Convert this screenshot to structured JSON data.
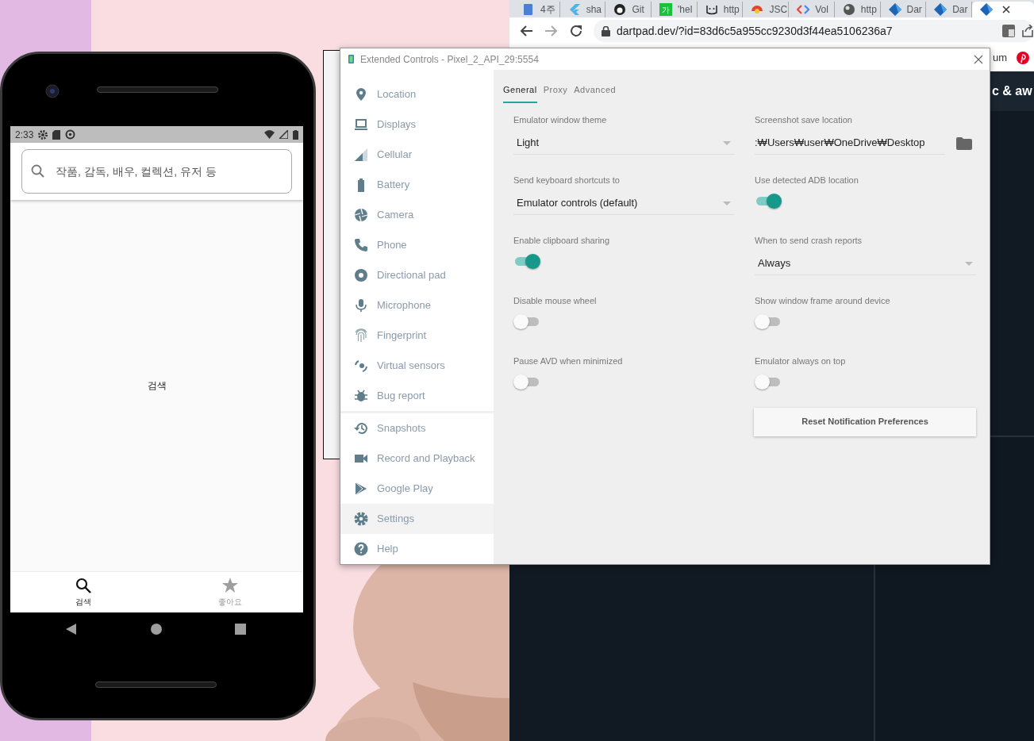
{
  "phone": {
    "status_time": "2:33",
    "search": {
      "placeholder": "작품, 감독, 배우, 컬렉션, 유저 등"
    },
    "body_text": "검색",
    "bottom_nav": [
      {
        "label": "검색",
        "selected": true
      },
      {
        "label": "좋아요",
        "selected": false
      }
    ]
  },
  "browser": {
    "tabs": [
      {
        "label": "4주",
        "selected": false
      },
      {
        "label": "sha",
        "selected": false
      },
      {
        "label": "Git",
        "selected": false
      },
      {
        "label": "'hel",
        "icon_text": "가",
        "selected": false
      },
      {
        "label": "http",
        "selected": false
      },
      {
        "label": "JSC",
        "selected": false
      },
      {
        "label": "Vol",
        "selected": false
      },
      {
        "label": "http",
        "selected": false
      },
      {
        "label": "Dar",
        "selected": false
      },
      {
        "label": "Dar",
        "selected": false
      },
      {
        "selected": true
      }
    ],
    "url": "dartpad.dev/?id=83d6c5a955cc9230d3f44ea5106236a7",
    "bookmark": "um",
    "page_heading": "c & aw"
  },
  "extended_controls": {
    "title": "Extended Controls - Pixel_2_API_29:5554",
    "sidebar": [
      [
        {
          "label": "Location",
          "selected": false
        },
        {
          "label": "Displays",
          "selected": false
        },
        {
          "label": "Cellular",
          "selected": false
        },
        {
          "label": "Battery",
          "selected": false
        },
        {
          "label": "Camera",
          "selected": false
        },
        {
          "label": "Phone",
          "selected": false
        },
        {
          "label": "Directional pad",
          "selected": false
        },
        {
          "label": "Microphone",
          "selected": false
        },
        {
          "label": "Fingerprint",
          "selected": false
        },
        {
          "label": "Virtual sensors",
          "selected": false
        },
        {
          "label": "Bug report",
          "selected": false
        }
      ],
      [
        {
          "label": "Snapshots",
          "selected": false
        },
        {
          "label": "Record and Playback",
          "selected": false
        },
        {
          "label": "Google Play",
          "selected": false
        },
        {
          "label": "Settings",
          "selected": true
        },
        {
          "label": "Help",
          "selected": false
        }
      ]
    ],
    "tabs": [
      {
        "label": "General",
        "selected": true
      },
      {
        "label": "Proxy",
        "selected": false
      },
      {
        "label": "Advanced",
        "selected": false
      }
    ],
    "settings": [
      {
        "kind": "select",
        "label": "Emulator window theme",
        "value": "Light"
      },
      {
        "kind": "path",
        "label": "Screenshot save location",
        "value": ":₩Users₩user₩OneDrive₩Desktop"
      },
      {
        "kind": "select",
        "label": "Send keyboard shortcuts to",
        "value": "Emulator controls (default)"
      },
      {
        "kind": "switch",
        "label": "Use detected ADB location",
        "on": true
      },
      {
        "kind": "switch",
        "label": "Enable clipboard sharing",
        "on": true
      },
      {
        "kind": "select",
        "label": "When to send crash reports",
        "value": "Always"
      },
      {
        "kind": "switch",
        "label": "Disable mouse wheel",
        "on": false
      },
      {
        "kind": "switch",
        "label": "Show window frame around device",
        "on": false
      },
      {
        "kind": "switch",
        "label": "Pause AVD when minimized",
        "on": false
      },
      {
        "kind": "switch",
        "label": "Emulator always on top",
        "on": false
      }
    ],
    "reset_button": "Reset Notification Preferences"
  }
}
